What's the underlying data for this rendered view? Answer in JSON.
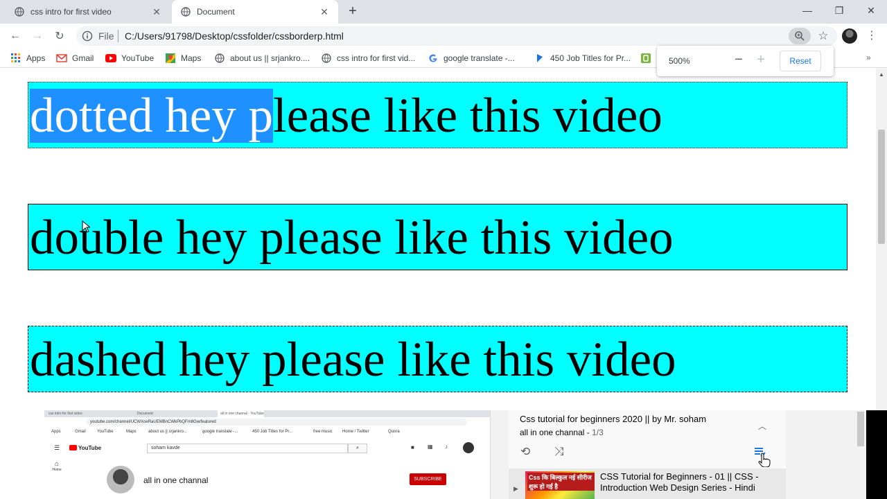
{
  "browser": {
    "tabs": [
      {
        "title": "css intro for first video",
        "active": false
      },
      {
        "title": "Document",
        "active": true
      }
    ],
    "address": {
      "scheme": "File",
      "url": "C:/Users/91798/Desktop/cssfolder/cssborderp.html"
    },
    "bookmarks": [
      {
        "label": "Apps",
        "icon": "apps-grid-icon"
      },
      {
        "label": "Gmail",
        "icon": "gmail-icon"
      },
      {
        "label": "YouTube",
        "icon": "youtube-icon"
      },
      {
        "label": "Maps",
        "icon": "maps-icon"
      },
      {
        "label": "about us || srjankro....",
        "icon": "globe-icon"
      },
      {
        "label": "css intro for first vid...",
        "icon": "globe-icon"
      },
      {
        "label": "google translate -...",
        "icon": "google-icon"
      },
      {
        "label": "450 Job Titles for Pr...",
        "icon": "bookmark-icon"
      }
    ],
    "zoom_bubble": {
      "percent": "500%",
      "minus": "−",
      "plus": "+",
      "reset": "Reset"
    }
  },
  "page": {
    "boxes": [
      {
        "selected": "dotted hey p",
        "rest": "lease like this video"
      },
      {
        "text": "double hey please like this video"
      },
      {
        "text": "dashed hey please like this video"
      }
    ]
  },
  "overlay": {
    "mini": {
      "tabs": [
        "css intro for first video",
        "Document",
        "all in one channal - YouTube"
      ],
      "url": "youtube.com/channel/UCWXoeRaUEMBnCWkPbQFm8Gw/featured",
      "bookmarks": [
        "Apps",
        "Gmail",
        "YouTube",
        "Maps",
        "about us || srjankro...",
        "google translate -...",
        "450 Job Titles for Pr...",
        "free music",
        "Home / Twitter",
        "Quora"
      ],
      "search_value": "soham kavde",
      "side": [
        "Home"
      ],
      "channel_name": "all in one channal",
      "subscribe": "SUBSCRIBE"
    },
    "playlist": {
      "title": "Css tutorial for beginners 2020 || by Mr. soham",
      "channel": "all in one channal",
      "position": "1/3",
      "video": {
        "thumb_text": "Css कि बिल्कुल नई सीरीज शुरू हो गई है",
        "title": "CSS Tutorial for Beginners - 01 ||  CSS - Introduction Web Design Series - Hindi"
      }
    }
  }
}
